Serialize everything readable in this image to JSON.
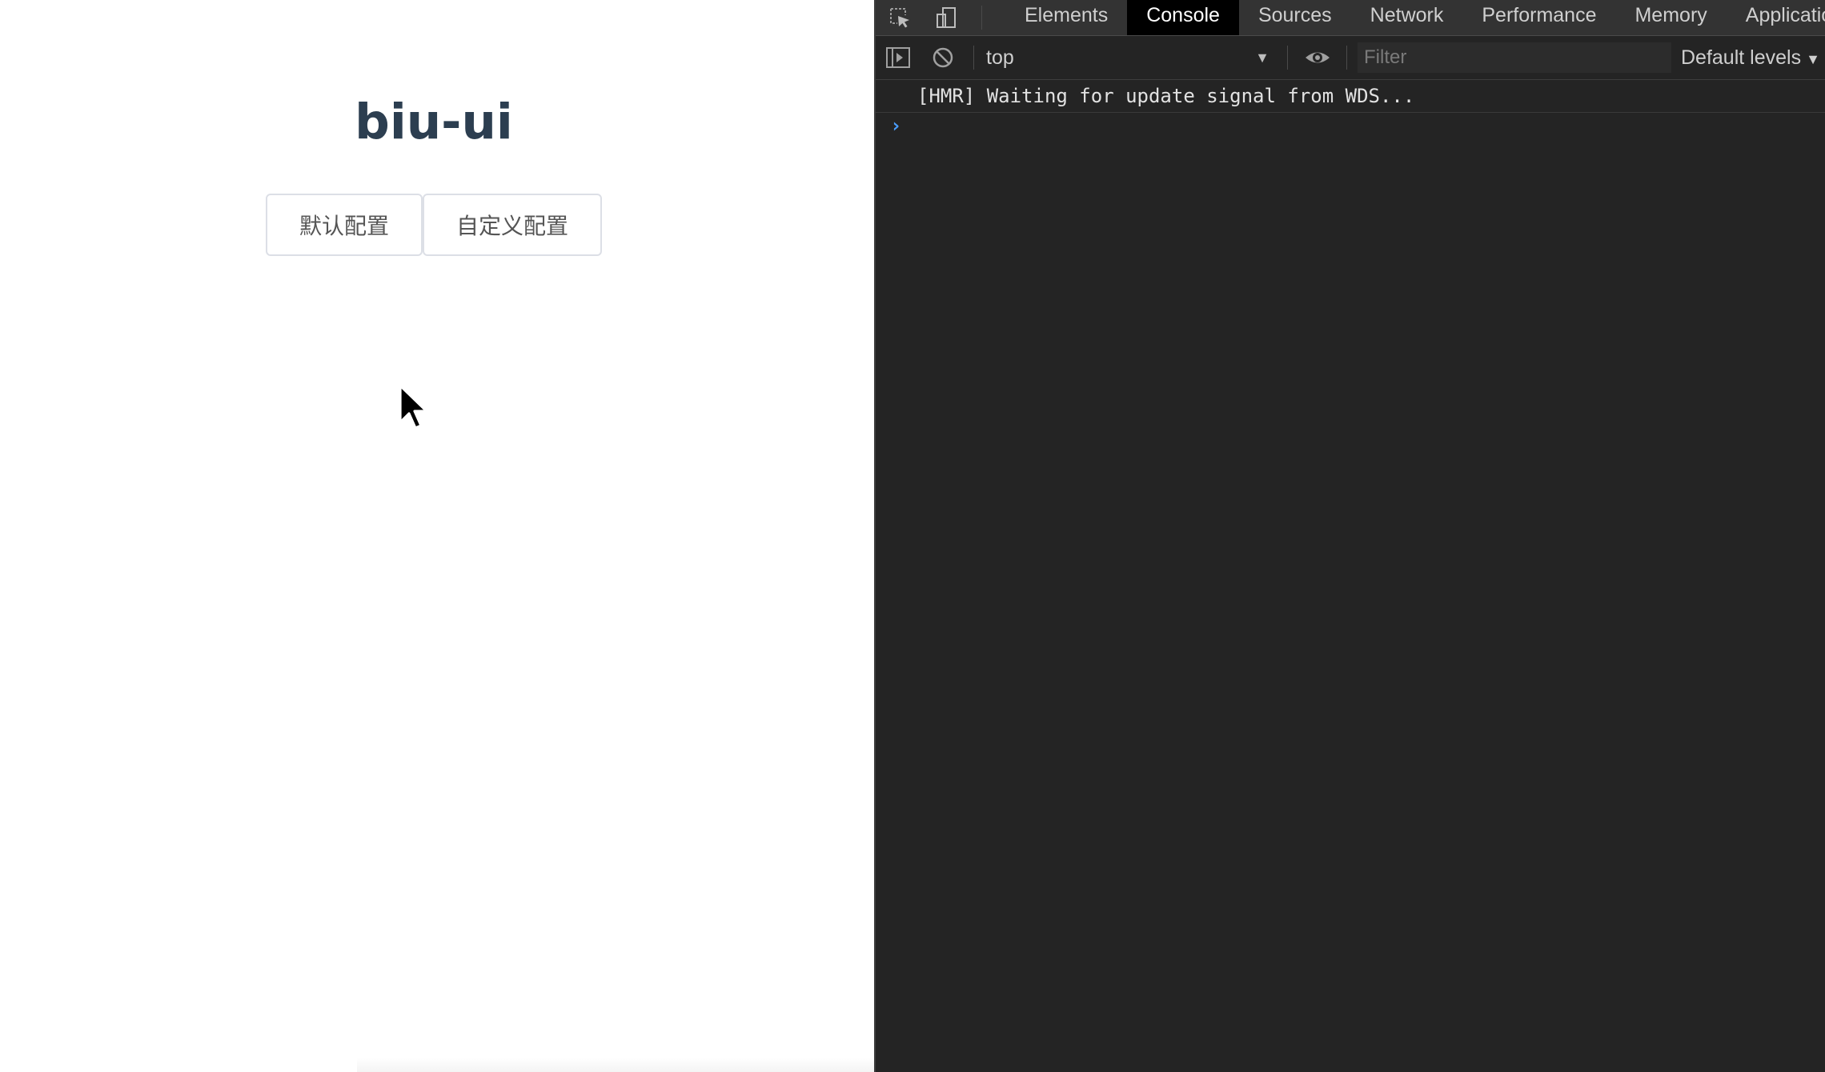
{
  "page": {
    "title": "biu-ui",
    "buttons": {
      "default_config": "默认配置",
      "custom_config": "自定义配置"
    }
  },
  "devtools": {
    "tabs": [
      {
        "label": "Elements",
        "active": false
      },
      {
        "label": "Console",
        "active": true
      },
      {
        "label": "Sources",
        "active": false
      },
      {
        "label": "Network",
        "active": false
      },
      {
        "label": "Performance",
        "active": false
      },
      {
        "label": "Memory",
        "active": false
      },
      {
        "label": "Application",
        "active": false
      }
    ],
    "toolbar": {
      "context": "top",
      "filter_placeholder": "Filter",
      "levels": "Default levels"
    },
    "console": {
      "messages": [
        "[HMR] Waiting for update signal from WDS..."
      ],
      "prompt": "›"
    },
    "colors": {
      "background": "#242424",
      "tabbar": "#333333",
      "active_tab": "#000000",
      "prompt": "#4a9eff"
    }
  }
}
